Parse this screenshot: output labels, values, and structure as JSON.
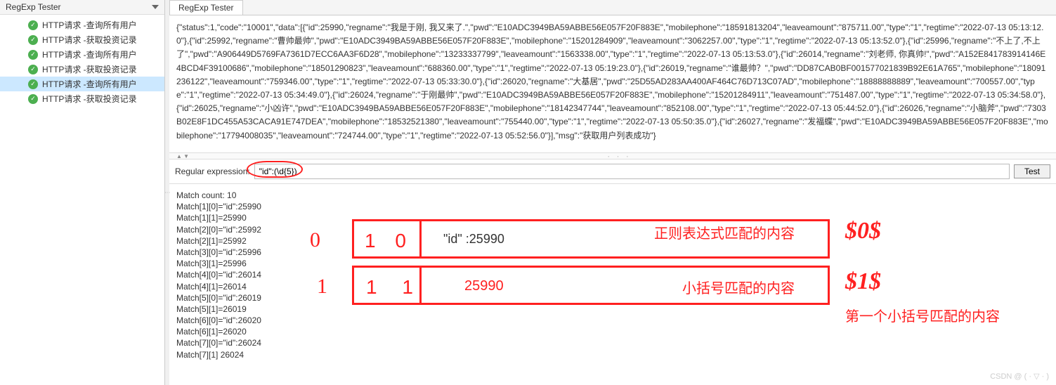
{
  "sidebar": {
    "title": "RegExp Tester",
    "items": [
      {
        "label": "HTTP请求 -查询所有用户",
        "selected": false
      },
      {
        "label": "HTTP请求 -获取投资记录",
        "selected": false
      },
      {
        "label": "HTTP请求 -查询所有用户",
        "selected": false
      },
      {
        "label": "HTTP请求 -获取投资记录",
        "selected": false
      },
      {
        "label": "HTTP请求 -查询所有用户",
        "selected": true
      },
      {
        "label": "HTTP请求 -获取投资记录",
        "selected": false
      }
    ]
  },
  "tab": {
    "label": "RegExp Tester"
  },
  "response_text": "{\"status\":1,\"code\":\"10001\",\"data\":[{\"id\":25990,\"regname\":\"我是于刚, 我又来了.\",\"pwd\":\"E10ADC3949BA59ABBE56E057F20F883E\",\"mobilephone\":\"18591813204\",\"leaveamount\":\"875711.00\",\"type\":\"1\",\"regtime\":\"2022-07-13 05:13:12.0\"},{\"id\":25992,\"regname\":\"曹帅最帅\",\"pwd\":\"E10ADC3949BA59ABBE56E057F20F883E\",\"mobilephone\":\"15201284909\",\"leaveamount\":\"3062257.00\",\"type\":\"1\",\"regtime\":\"2022-07-13 05:13:52.0\"},{\"id\":25996,\"regname\":\"不上了,不上了\",\"pwd\":\"A906449D5769FA7361D7ECC6AA3F6D28\",\"mobilephone\":\"13233337799\",\"leaveamount\":\"1563338.00\",\"type\":\"1\",\"regtime\":\"2022-07-13 05:13:53.0\"},{\"id\":26014,\"regname\":\"刘老师, 你真帅!\",\"pwd\":\"A152E841783914146E4BCD4F39100686\",\"mobilephone\":\"18501290823\",\"leaveamount\":\"688360.00\",\"type\":\"1\",\"regtime\":\"2022-07-13 05:19:23.0\"},{\"id\":26019,\"regname\":\"谁最帅？\",\"pwd\":\"DD87CAB0BF001577021839B92E61A765\",\"mobilephone\":\"18091236122\",\"leaveamount\":\"759346.00\",\"type\":\"1\",\"regtime\":\"2022-07-13 05:33:30.0\"},{\"id\":26020,\"regname\":\"大基居\",\"pwd\":\"25D55AD283AA400AF464C76D713C07AD\",\"mobilephone\":\"18888888889\",\"leaveamount\":\"700557.00\",\"type\":\"1\",\"regtime\":\"2022-07-13 05:34:49.0\"},{\"id\":26024,\"regname\":\"于刚最帅\",\"pwd\":\"E10ADC3949BA59ABBE56E057F20F883E\",\"mobilephone\":\"15201284911\",\"leaveamount\":\"751487.00\",\"type\":\"1\",\"regtime\":\"2022-07-13 05:34:58.0\"},{\"id\":26025,\"regname\":\"小凶许\",\"pwd\":\"E10ADC3949BA59ABBE56E057F20F883E\",\"mobilephone\":\"18142347744\",\"leaveamount\":\"852108.00\",\"type\":\"1\",\"regtime\":\"2022-07-13 05:44:52.0\"},{\"id\":26026,\"regname\":\"小脑斧\",\"pwd\":\"7303B02E8F1DC455A53CACA91E747DEA\",\"mobilephone\":\"18532521380\",\"leaveamount\":\"755440.00\",\"type\":\"1\",\"regtime\":\"2022-07-13 05:50:35.0\"},{\"id\":26027,\"regname\":\"发福蝶\",\"pwd\":\"E10ADC3949BA59ABBE56E057F20F883E\",\"mobilephone\":\"17794008035\",\"leaveamount\":\"724744.00\",\"type\":\"1\",\"regtime\":\"2022-07-13 05:52:56.0\"}],\"msg\":\"获取用户列表成功\"}",
  "regex": {
    "label": "Regular expression:",
    "value": "\"id\":(\\d{5})",
    "test_label": "Test"
  },
  "results": {
    "count_label": "Match count: 10",
    "lines": [
      "Match[1][0]=\"id\":25990",
      "Match[1][1]=25990",
      "Match[2][0]=\"id\":25992",
      "Match[2][1]=25992",
      "Match[3][0]=\"id\":25996",
      "Match[3][1]=25996",
      "Match[4][0]=\"id\":26014",
      "Match[4][1]=26014",
      "Match[5][0]=\"id\":26019",
      "Match[5][1]=26019",
      "Match[6][0]=\"id\":26020",
      "Match[6][1]=26020",
      "Match[7][0]=\"id\":26024",
      "Match[7][1]  26024"
    ]
  },
  "annotations": {
    "box1_idx": "1 0",
    "box1_text": "\"id\" :25990",
    "box1_label": "正则表达式匹配的内容",
    "box2_idx": "1 1",
    "box2_text": "25990",
    "box2_label": "小括号匹配的内容",
    "hand0": "0",
    "hand1": "1",
    "hand_dollar0": "$0$",
    "hand_dollar1": "$1$",
    "explain_dollar1": "第一个小括号匹配的内容"
  },
  "watermark": "CSDN @"
}
